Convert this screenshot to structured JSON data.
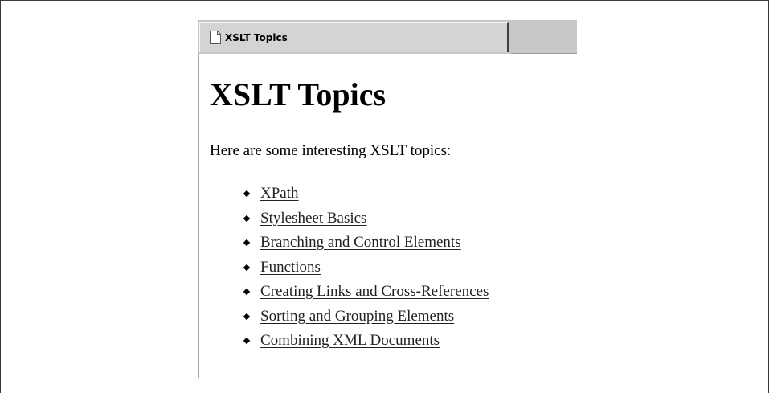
{
  "tab": {
    "title": "XSLT Topics",
    "icon": "document-icon"
  },
  "page": {
    "heading": "XSLT Topics",
    "intro": "Here are some interesting XSLT topics:",
    "topics": [
      "XPath",
      "Stylesheet Basics",
      "Branching and Control Elements",
      "Functions",
      "Creating Links and Cross-References",
      "Sorting and Grouping Elements",
      "Combining XML Documents"
    ]
  }
}
